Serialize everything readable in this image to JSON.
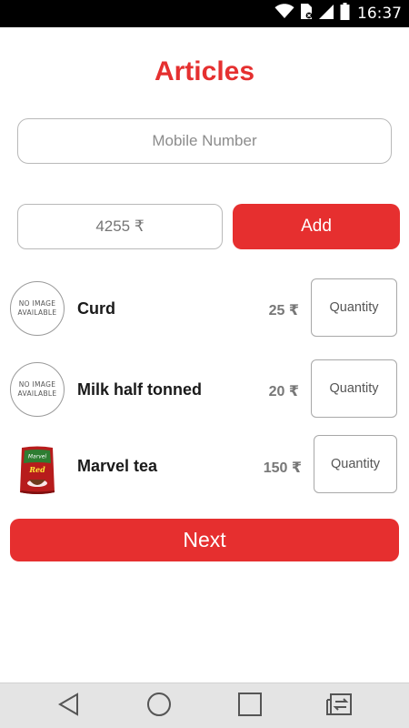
{
  "status_bar": {
    "time": "16:37",
    "icons": [
      "wifi-icon",
      "sim-card-icon",
      "signal-icon",
      "battery-icon"
    ]
  },
  "page": {
    "title": "Articles"
  },
  "form": {
    "mobile_placeholder": "Mobile Number",
    "amount_placeholder": "4255 ₹",
    "add_label": "Add"
  },
  "articles": [
    {
      "name": "Curd",
      "price": "25 ₹",
      "image_text": "NO IMAGE AVAILABLE",
      "image_line1": "NO IMAGE",
      "image_line2": "AVAILABLE",
      "quantity_placeholder": "Quantity"
    },
    {
      "name": "Milk half tonned",
      "price": "20 ₹",
      "image_text": "NO IMAGE AVAILABLE",
      "image_line1": "NO IMAGE",
      "image_line2": "AVAILABLE",
      "quantity_placeholder": "Quantity"
    },
    {
      "name": "Marvel tea",
      "price": "150 ₹",
      "image": "marvel-tea-pack",
      "pack_brand": "Marvel",
      "pack_variant": "Red",
      "quantity_placeholder": "Quantity"
    }
  ],
  "next_label": "Next",
  "nav_bar": {
    "buttons": [
      "back-icon",
      "home-icon",
      "recents-icon",
      "switch-sim-icon"
    ]
  },
  "colors": {
    "accent": "#e62f2f",
    "title": "#e53030",
    "status_bar": "#000000",
    "nav_bar": "#e4e4e4"
  }
}
